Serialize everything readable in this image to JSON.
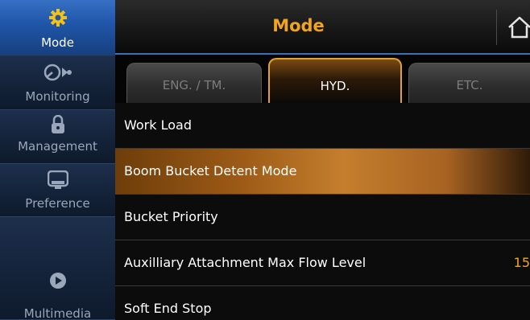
{
  "sidebar": {
    "items": [
      {
        "label": "Mode",
        "icon": "gear-icon",
        "active": true
      },
      {
        "label": "Monitoring",
        "icon": "gauge-icon",
        "active": false
      },
      {
        "label": "Management",
        "icon": "lock-icon",
        "active": false
      },
      {
        "label": "Preference",
        "icon": "monitor-icon",
        "active": false
      },
      {
        "label": "Multimedia",
        "icon": "play-icon",
        "active": false
      }
    ]
  },
  "header": {
    "title": "Mode",
    "home_icon": "home-icon"
  },
  "tabs": [
    {
      "label": "ENG. / TM.",
      "active": false
    },
    {
      "label": "HYD.",
      "active": true
    },
    {
      "label": "ETC.",
      "active": false
    }
  ],
  "list": {
    "items": [
      {
        "label": "Work Load",
        "value": ""
      },
      {
        "label": "Boom Bucket Detent Mode",
        "value": "",
        "highlighted": true
      },
      {
        "label": "Bucket Priority",
        "value": ""
      },
      {
        "label": "Auxilliary Attachment Max Flow Level",
        "value": "15"
      },
      {
        "label": "Soft End Stop",
        "value": ""
      }
    ]
  },
  "colors": {
    "accent": "#f2a51a",
    "sidebar_active": "#1f55a8",
    "sidebar_bg": "#14233a",
    "highlight_row": "#c57e2d"
  }
}
